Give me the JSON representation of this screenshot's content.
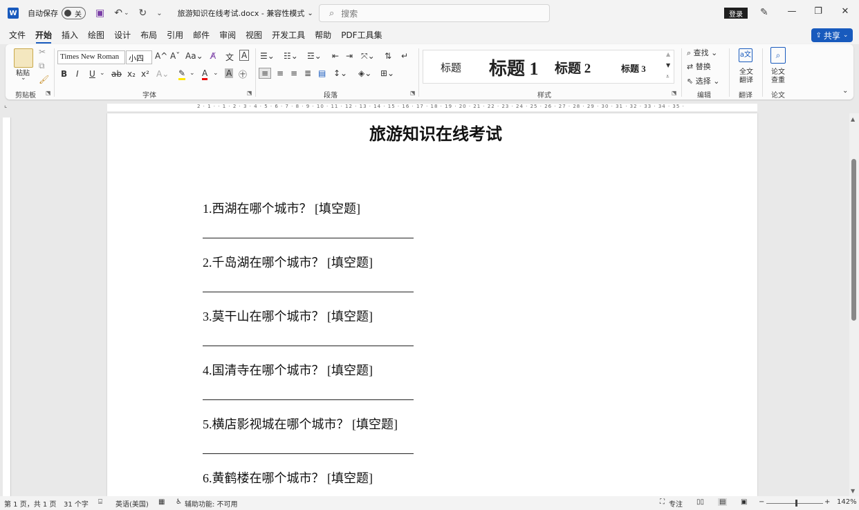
{
  "titlebar": {
    "autosave_label": "自动保存",
    "autosave_state": "关",
    "doc_title": "旅游知识在线考试.docx  -  兼容性模式",
    "search_placeholder": "搜索",
    "login_label": "登录"
  },
  "menu": {
    "tabs": [
      "文件",
      "开始",
      "插入",
      "绘图",
      "设计",
      "布局",
      "引用",
      "邮件",
      "审阅",
      "视图",
      "开发工具",
      "帮助",
      "PDF工具集"
    ],
    "active": "开始",
    "share_label": "共享"
  },
  "ribbon": {
    "clipboard": {
      "paste_label": "粘贴",
      "group_label": "剪贴板"
    },
    "font": {
      "font_name": "Times New Roman",
      "font_size": "小四",
      "group_label": "字体"
    },
    "paragraph": {
      "group_label": "段落"
    },
    "styles": {
      "items": [
        "标题",
        "标题 1",
        "标题 2",
        "标题 3"
      ],
      "group_label": "样式"
    },
    "editing": {
      "find_label": "查找",
      "replace_label": "替换",
      "select_label": "选择",
      "group_label": "编辑"
    },
    "translate": {
      "button_label_1": "全文",
      "button_label_2": "翻译",
      "group_label": "翻译"
    },
    "paper": {
      "button_label_1": "论文",
      "button_label_2": "查重",
      "group_label": "论文"
    }
  },
  "document": {
    "heading": "旅游知识在线考试",
    "questions": [
      "1.西湖在哪个城市？ [填空题]",
      "2.千岛湖在哪个城市？ [填空题]",
      "3.莫干山在哪个城市？ [填空题]",
      "4.国清寺在哪个城市？ [填空题]",
      "5.横店影视城在哪个城市？ [填空题]",
      "6.黄鹤楼在哪个城市？ [填空题]"
    ]
  },
  "ruler": {
    "ticks": "2 · 1 · · 1 · 2 · 3 · 4 · 5 · 6 · 7 · 8 · 9 · 10 · 11 · 12 · 13 · 14 · 15 · 16 · 17 · 18 · 19 · 20 · 21 · 22 · 23 · 24 · 25 · 26 · 27 · 28 · 29 · 30 · 31 · 32 · 33 · 34 · 35 ·"
  },
  "statusbar": {
    "page_info": "第 1 页，共 1 页",
    "word_count": "31 个字",
    "language": "英语(美国)",
    "accessibility": "辅助功能: 不可用",
    "focus_label": "专注",
    "zoom": "142%"
  },
  "colors": {
    "accent": "#185abd",
    "text": "#111111"
  }
}
